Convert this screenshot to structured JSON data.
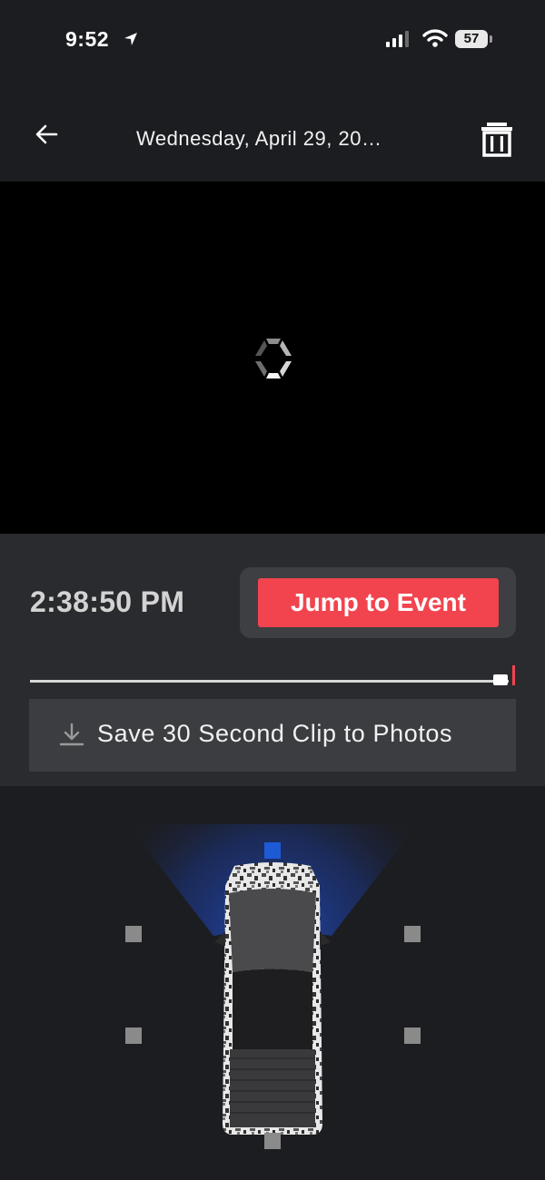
{
  "status_bar": {
    "time": "9:52",
    "battery": "57"
  },
  "header": {
    "title": "Wednesday, April 29, 20…"
  },
  "player": {
    "clip_time": "2:38:50 PM",
    "jump_label": "Jump to Event",
    "save_label": "Save 30 Second Clip to Photos",
    "scrub_position": 0.98
  },
  "icons": {
    "back": "arrow-left-icon",
    "delete": "trash-icon",
    "loading": "hexagon-spinner-icon",
    "download": "download-icon",
    "location": "location-arrow-icon",
    "signal": "cellular-signal-icon",
    "wifi": "wifi-icon"
  },
  "colors": {
    "accent_red": "#f1444e",
    "camera_active_blue": "#1d5bd6",
    "background": "#1c1d20",
    "panel": "#2a2b2e"
  }
}
